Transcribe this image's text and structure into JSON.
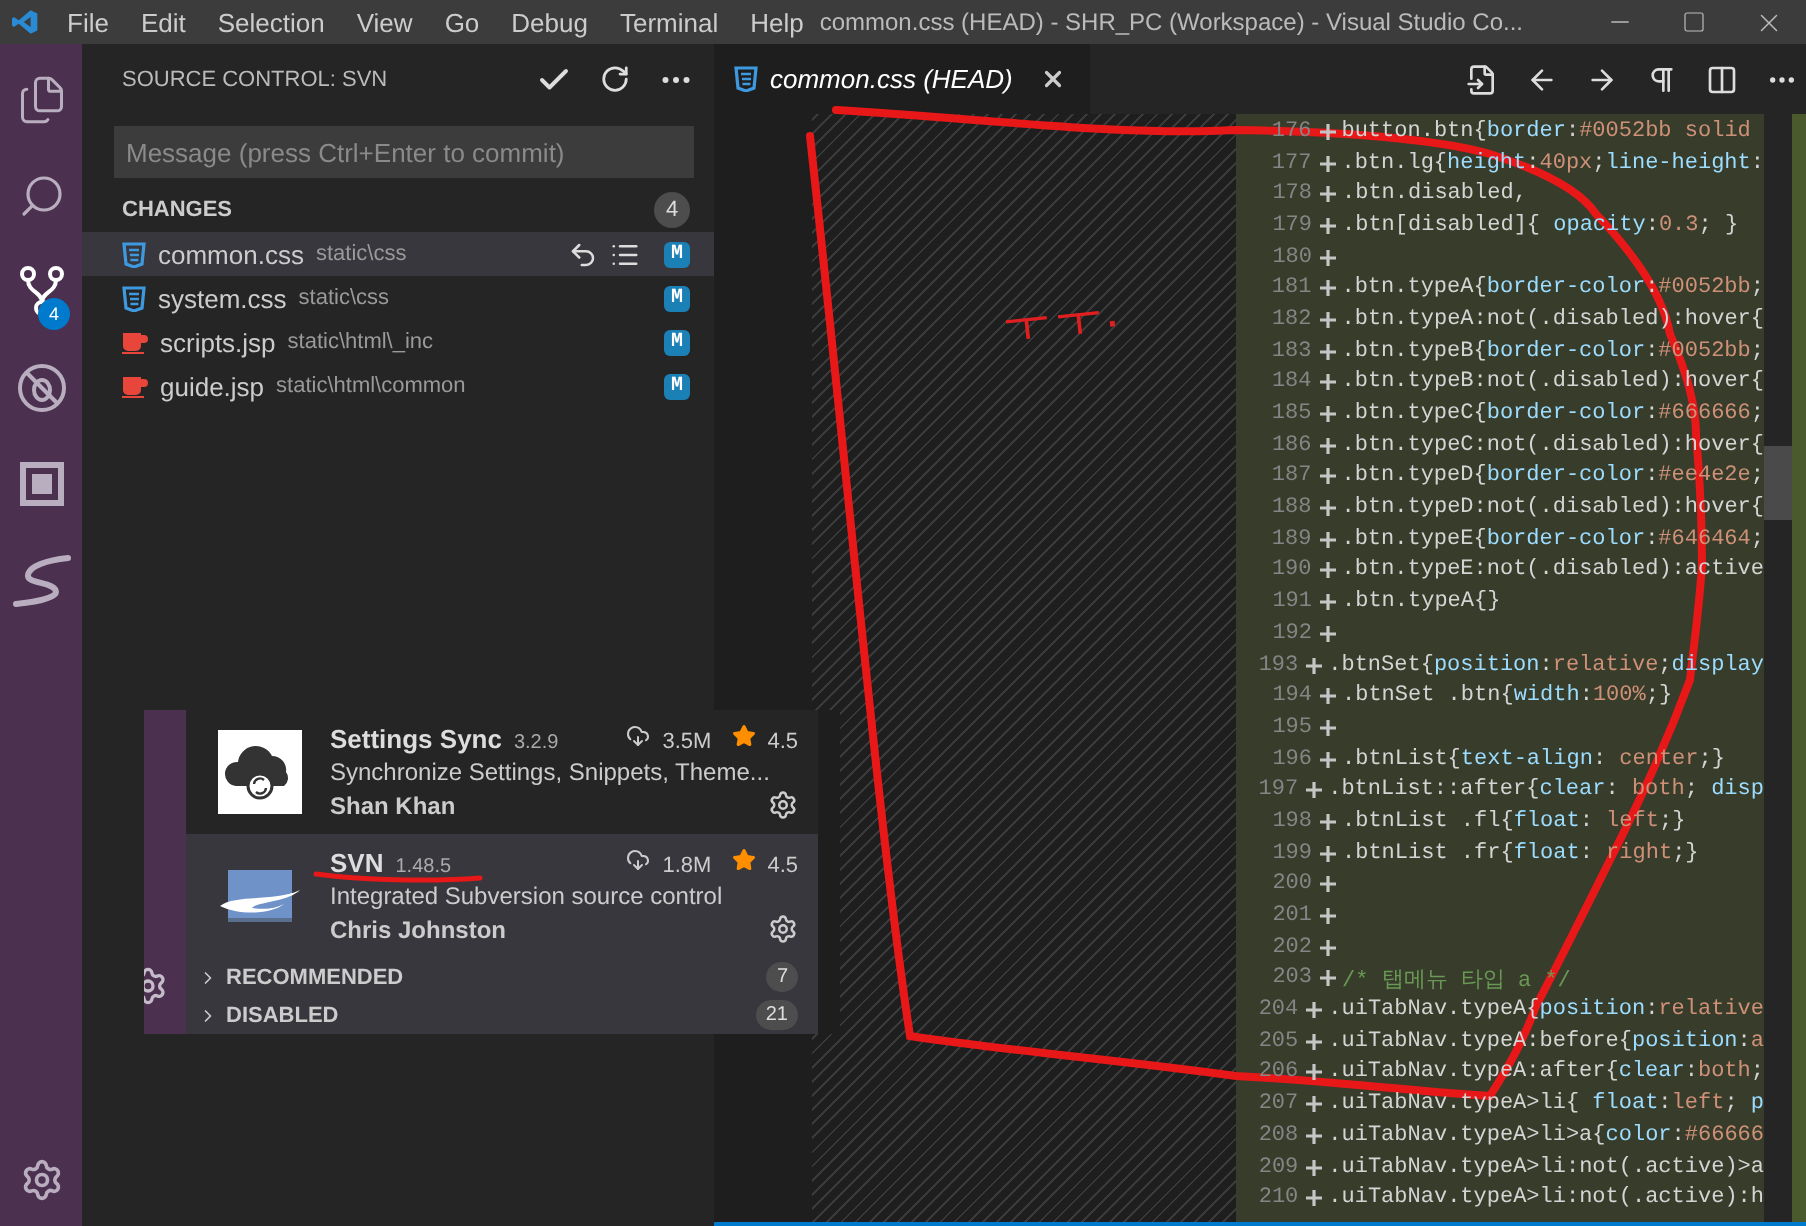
{
  "titlebar": {
    "menu": [
      "File",
      "Edit",
      "Selection",
      "View",
      "Go",
      "Debug",
      "Terminal",
      "Help"
    ],
    "title": "common.css (HEAD) - SHR_PC (Workspace) - Visual Studio Co..."
  },
  "activity_bar": [
    {
      "kind": "explorer",
      "selected": false
    },
    {
      "kind": "search",
      "selected": false
    },
    {
      "kind": "scm",
      "selected": true,
      "badge": "4"
    },
    {
      "kind": "debug",
      "selected": false
    },
    {
      "kind": "extensions",
      "selected": false
    },
    {
      "kind": "svn",
      "selected": false
    }
  ],
  "sidebar": {
    "title": "SOURCE CONTROL: SVN",
    "message": {
      "placeholder": "Message (press Ctrl+Enter to commit)"
    },
    "section": {
      "label": "CHANGES",
      "count": "4"
    },
    "files": [
      {
        "kind": "css",
        "name": "common.css",
        "path": "static\\css",
        "status": "M",
        "selected": true
      },
      {
        "kind": "css",
        "name": "system.css",
        "path": "static\\css",
        "status": "M",
        "selected": false
      },
      {
        "kind": "jsp",
        "name": "scripts.jsp",
        "path": "static\\html\\_inc",
        "status": "M",
        "selected": false
      },
      {
        "kind": "jsp",
        "name": "guide.jsp",
        "path": "static\\html\\common",
        "status": "M",
        "selected": false
      }
    ]
  },
  "tabs": [
    {
      "kind": "css",
      "title": "common.css (HEAD)",
      "selected": true
    }
  ],
  "code": [
    {
      "number": "176",
      "added": true,
      "kind": "code",
      "text": "button.btn{border:#0052bb solid "
    },
    {
      "number": "177",
      "added": true,
      "kind": "code",
      "text": ".btn.lg{height:40px;line-height:"
    },
    {
      "number": "178",
      "added": true,
      "kind": "code",
      "text": ".btn.disabled,"
    },
    {
      "number": "179",
      "added": true,
      "kind": "code",
      "text": ".btn[disabled]{ opacity:0.3; }"
    },
    {
      "number": "180",
      "added": true
    },
    {
      "number": "181",
      "added": true,
      "kind": "code",
      "text": ".btn.typeA{border-color:#0052bb;"
    },
    {
      "number": "182",
      "added": true,
      "kind": "code",
      "text": ".btn.typeA:not(.disabled):hover{"
    },
    {
      "number": "183",
      "added": true,
      "kind": "code",
      "text": ".btn.typeB{border-color:#0052bb;"
    },
    {
      "number": "184",
      "added": true,
      "kind": "code",
      "text": ".btn.typeB:not(.disabled):hover{"
    },
    {
      "number": "185",
      "added": true,
      "kind": "code",
      "text": ".btn.typeC{border-color:#666666;"
    },
    {
      "number": "186",
      "added": true,
      "kind": "code",
      "text": ".btn.typeC:not(.disabled):hover{"
    },
    {
      "number": "187",
      "added": true,
      "kind": "code",
      "text": ".btn.typeD{border-color:#ee4e2e;"
    },
    {
      "number": "188",
      "added": true,
      "kind": "code",
      "text": ".btn.typeD:not(.disabled):hover{"
    },
    {
      "number": "189",
      "added": true,
      "kind": "code",
      "text": ".btn.typeE{border-color:#646464;"
    },
    {
      "number": "190",
      "added": true,
      "kind": "code",
      "text": ".btn.typeE:not(.disabled):active"
    },
    {
      "number": "191",
      "added": true,
      "kind": "code",
      "text": ".btn.typeA{}"
    },
    {
      "number": "192",
      "added": true
    },
    {
      "number": "193",
      "added": true,
      "kind": "code",
      "text": ".btnSet{position:relative;display"
    },
    {
      "number": "194",
      "added": true,
      "kind": "code",
      "text": ".btnSet .btn{width:100%;}"
    },
    {
      "number": "195",
      "added": true
    },
    {
      "number": "196",
      "added": true,
      "kind": "code",
      "text": ".btnList{text-align: center;}"
    },
    {
      "number": "197",
      "added": true,
      "kind": "code",
      "text": ".btnList::after{clear: both; disp"
    },
    {
      "number": "198",
      "added": true,
      "kind": "code",
      "text": ".btnList .fl{float: left;}"
    },
    {
      "number": "199",
      "added": true,
      "kind": "code",
      "text": ".btnList .fr{float: right;}"
    },
    {
      "number": "200",
      "added": true
    },
    {
      "number": "201",
      "added": true
    },
    {
      "number": "202",
      "added": true
    },
    {
      "number": "203",
      "added": true,
      "kind": "comment",
      "text": "/* 탭메뉴 타입 a */"
    },
    {
      "number": "204",
      "added": true,
      "kind": "code",
      "text": ".uiTabNav.typeA{position:relative"
    },
    {
      "number": "205",
      "added": true,
      "kind": "code",
      "text": ".uiTabNav.typeA:before{position:a"
    },
    {
      "number": "206",
      "added": true,
      "kind": "code",
      "text": ".uiTabNav.typeA:after{clear:both;"
    },
    {
      "number": "207",
      "added": true,
      "kind": "code",
      "text": ".uiTabNav.typeA>li{ float:left; p"
    },
    {
      "number": "208",
      "added": true,
      "kind": "code",
      "text": ".uiTabNav.typeA>li>a{color:#66666"
    },
    {
      "number": "209",
      "added": true,
      "kind": "code",
      "text": ".uiTabNav.typeA>li:not(.active)>a"
    },
    {
      "number": "210",
      "added": true,
      "kind": "code",
      "text": ".uiTabNav.typeA>li:not(.active):h"
    }
  ],
  "extensions_inset": {
    "items": [
      {
        "kind": "cloud",
        "name": "Settings Sync",
        "version": "3.2.9",
        "downloads": "3.5M",
        "rating": "4.5",
        "description": "Synchronize Settings, Snippets, Theme...",
        "author": "Shan Khan",
        "selected": false
      },
      {
        "kind": "svn",
        "name": "SVN",
        "version": "1.48.5",
        "downloads": "1.8M",
        "rating": "4.5",
        "description": "Integrated Subversion source control",
        "author": "Chris Johnston",
        "selected": true
      }
    ],
    "sections": [
      {
        "label": "RECOMMENDED",
        "count": "7",
        "expanded": false
      },
      {
        "label": "DISABLED",
        "count": "21",
        "expanded": false
      }
    ]
  },
  "annotation": {
    "note": "ㅜㅜ."
  }
}
